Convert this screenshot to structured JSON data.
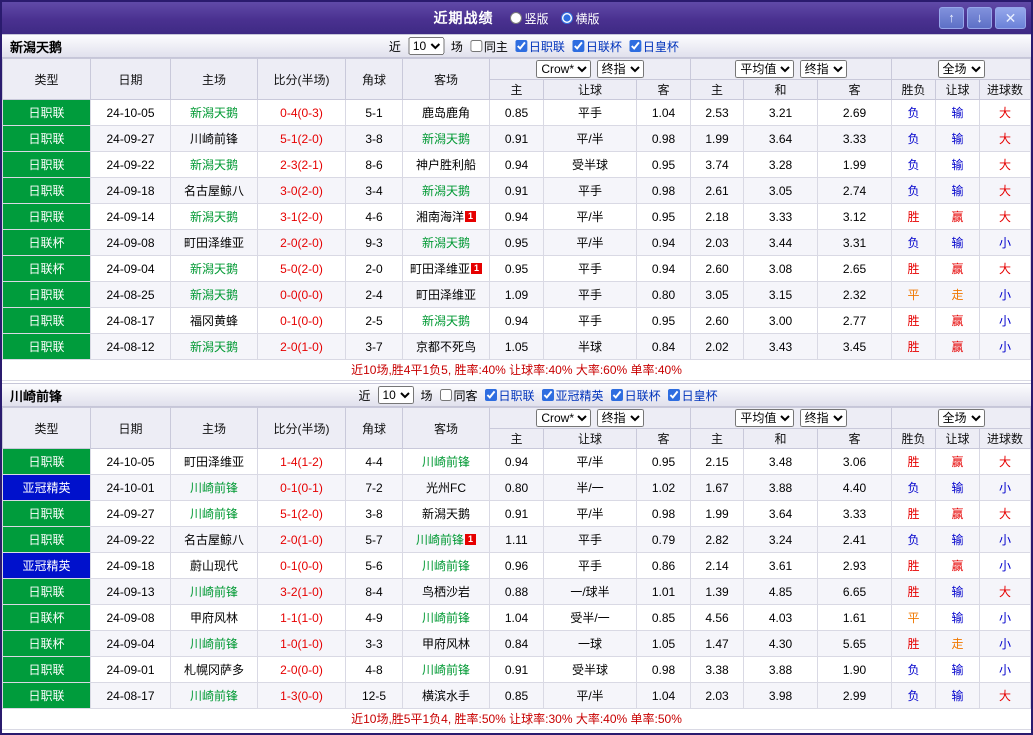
{
  "colors": {
    "accent_purple": "#4a3190",
    "league_green": "#009c3c",
    "league_blue": "#0011cc",
    "team_green": "#009933",
    "score_red": "#e60000",
    "lose_blue": "#0000cc",
    "draw_orange": "#f07800",
    "summary_red": "#c80000"
  },
  "titlebar": {
    "title": "近期战绩",
    "layout_options": [
      "竖版",
      "横版"
    ],
    "selected_layout": "横版",
    "up_glyph": "↑",
    "down_glyph": "↓",
    "close_glyph": "✕"
  },
  "filters": {
    "near": "近",
    "games_suffix": "场"
  },
  "table_header": {
    "type": "类型",
    "date": "日期",
    "home": "主场",
    "score": "比分(半场)",
    "corner": "角球",
    "away": "客场",
    "book_select": "Crow*",
    "final_select": "终指",
    "avg_select": "平均值",
    "scope_select": "全场",
    "sub": [
      "主",
      "让球",
      "客",
      "主",
      "和",
      "客",
      "胜负",
      "让球",
      "进球数"
    ]
  },
  "sections": [
    {
      "team": "新潟天鹅",
      "games": "10",
      "checkboxes": [
        {
          "label": "同主",
          "checked": false,
          "hl": false
        },
        {
          "label": "日职联",
          "checked": true,
          "hl": true
        },
        {
          "label": "日联杯",
          "checked": true,
          "hl": true
        },
        {
          "label": "日皇杯",
          "checked": true,
          "hl": true
        }
      ],
      "rows": [
        [
          {
            "t": "日职联",
            "c": "lg"
          },
          {
            "t": "24-10-05"
          },
          {
            "t": "新潟天鹅",
            "c": "tg"
          },
          {
            "t": "0-4(0-3)",
            "c": "sc"
          },
          {
            "t": "5-1"
          },
          {
            "t": "鹿岛鹿角"
          },
          {
            "t": "0.85"
          },
          {
            "t": "平手"
          },
          {
            "t": "1.04"
          },
          {
            "t": "2.53"
          },
          {
            "t": "3.21"
          },
          {
            "t": "2.69"
          },
          {
            "t": "负",
            "c": "bl"
          },
          {
            "t": "输",
            "c": "bl"
          },
          {
            "t": "大",
            "c": "rd"
          }
        ],
        [
          {
            "t": "日职联",
            "c": "lg"
          },
          {
            "t": "24-09-27"
          },
          {
            "t": "川崎前锋"
          },
          {
            "t": "5-1(2-0)",
            "c": "sc"
          },
          {
            "t": "3-8"
          },
          {
            "t": "新潟天鹅",
            "c": "tg"
          },
          {
            "t": "0.91"
          },
          {
            "t": "平/半"
          },
          {
            "t": "0.98"
          },
          {
            "t": "1.99"
          },
          {
            "t": "3.64"
          },
          {
            "t": "3.33"
          },
          {
            "t": "负",
            "c": "bl"
          },
          {
            "t": "输",
            "c": "bl"
          },
          {
            "t": "大",
            "c": "rd"
          }
        ],
        [
          {
            "t": "日职联",
            "c": "lg"
          },
          {
            "t": "24-09-22"
          },
          {
            "t": "新潟天鹅",
            "c": "tg"
          },
          {
            "t": "2-3(2-1)",
            "c": "sc"
          },
          {
            "t": "8-6"
          },
          {
            "t": "神户胜利船"
          },
          {
            "t": "0.94"
          },
          {
            "t": "受半球"
          },
          {
            "t": "0.95"
          },
          {
            "t": "3.74"
          },
          {
            "t": "3.28"
          },
          {
            "t": "1.99"
          },
          {
            "t": "负",
            "c": "bl"
          },
          {
            "t": "输",
            "c": "bl"
          },
          {
            "t": "大",
            "c": "rd"
          }
        ],
        [
          {
            "t": "日职联",
            "c": "lg"
          },
          {
            "t": "24-09-18"
          },
          {
            "t": "名古屋鲸八"
          },
          {
            "t": "3-0(2-0)",
            "c": "sc"
          },
          {
            "t": "3-4"
          },
          {
            "t": "新潟天鹅",
            "c": "tg"
          },
          {
            "t": "0.91"
          },
          {
            "t": "平手"
          },
          {
            "t": "0.98"
          },
          {
            "t": "2.61"
          },
          {
            "t": "3.05"
          },
          {
            "t": "2.74"
          },
          {
            "t": "负",
            "c": "bl"
          },
          {
            "t": "输",
            "c": "bl"
          },
          {
            "t": "大",
            "c": "rd"
          }
        ],
        [
          {
            "t": "日职联",
            "c": "lg"
          },
          {
            "t": "24-09-14"
          },
          {
            "t": "新潟天鹅",
            "c": "tg"
          },
          {
            "t": "3-1(2-0)",
            "c": "sc"
          },
          {
            "t": "4-6"
          },
          {
            "t": "湘南海洋",
            "b": "1"
          },
          {
            "t": "0.94"
          },
          {
            "t": "平/半"
          },
          {
            "t": "0.95"
          },
          {
            "t": "2.18"
          },
          {
            "t": "3.33"
          },
          {
            "t": "3.12"
          },
          {
            "t": "胜",
            "c": "rd"
          },
          {
            "t": "赢",
            "c": "rd"
          },
          {
            "t": "大",
            "c": "rd"
          }
        ],
        [
          {
            "t": "日联杯",
            "c": "lg"
          },
          {
            "t": "24-09-08"
          },
          {
            "t": "町田泽维亚"
          },
          {
            "t": "2-0(2-0)",
            "c": "sc"
          },
          {
            "t": "9-3"
          },
          {
            "t": "新潟天鹅",
            "c": "tg"
          },
          {
            "t": "0.95"
          },
          {
            "t": "平/半"
          },
          {
            "t": "0.94"
          },
          {
            "t": "2.03"
          },
          {
            "t": "3.44"
          },
          {
            "t": "3.31"
          },
          {
            "t": "负",
            "c": "bl"
          },
          {
            "t": "输",
            "c": "bl"
          },
          {
            "t": "小",
            "c": "bl"
          }
        ],
        [
          {
            "t": "日联杯",
            "c": "lg"
          },
          {
            "t": "24-09-04"
          },
          {
            "t": "新潟天鹅",
            "c": "tg"
          },
          {
            "t": "5-0(2-0)",
            "c": "sc"
          },
          {
            "t": "2-0"
          },
          {
            "t": "町田泽维亚",
            "b": "1"
          },
          {
            "t": "0.95"
          },
          {
            "t": "平手"
          },
          {
            "t": "0.94"
          },
          {
            "t": "2.60"
          },
          {
            "t": "3.08"
          },
          {
            "t": "2.65"
          },
          {
            "t": "胜",
            "c": "rd"
          },
          {
            "t": "赢",
            "c": "rd"
          },
          {
            "t": "大",
            "c": "rd"
          }
        ],
        [
          {
            "t": "日职联",
            "c": "lg"
          },
          {
            "t": "24-08-25"
          },
          {
            "t": "新潟天鹅",
            "c": "tg"
          },
          {
            "t": "0-0(0-0)",
            "c": "sc"
          },
          {
            "t": "2-4"
          },
          {
            "t": "町田泽维亚"
          },
          {
            "t": "1.09"
          },
          {
            "t": "平手"
          },
          {
            "t": "0.80"
          },
          {
            "t": "3.05"
          },
          {
            "t": "3.15"
          },
          {
            "t": "2.32"
          },
          {
            "t": "平",
            "c": "og"
          },
          {
            "t": "走",
            "c": "og"
          },
          {
            "t": "小",
            "c": "bl"
          }
        ],
        [
          {
            "t": "日职联",
            "c": "lg"
          },
          {
            "t": "24-08-17"
          },
          {
            "t": "福冈黄蜂"
          },
          {
            "t": "0-1(0-0)",
            "c": "sc"
          },
          {
            "t": "2-5"
          },
          {
            "t": "新潟天鹅",
            "c": "tg"
          },
          {
            "t": "0.94"
          },
          {
            "t": "平手"
          },
          {
            "t": "0.95"
          },
          {
            "t": "2.60"
          },
          {
            "t": "3.00"
          },
          {
            "t": "2.77"
          },
          {
            "t": "胜",
            "c": "rd"
          },
          {
            "t": "赢",
            "c": "rd"
          },
          {
            "t": "小",
            "c": "bl"
          }
        ],
        [
          {
            "t": "日职联",
            "c": "lg"
          },
          {
            "t": "24-08-12"
          },
          {
            "t": "新潟天鹅",
            "c": "tg"
          },
          {
            "t": "2-0(1-0)",
            "c": "sc"
          },
          {
            "t": "3-7"
          },
          {
            "t": "京都不死鸟"
          },
          {
            "t": "1.05"
          },
          {
            "t": "半球"
          },
          {
            "t": "0.84"
          },
          {
            "t": "2.02"
          },
          {
            "t": "3.43"
          },
          {
            "t": "3.45"
          },
          {
            "t": "胜",
            "c": "rd"
          },
          {
            "t": "赢",
            "c": "rd"
          },
          {
            "t": "小",
            "c": "bl"
          }
        ]
      ],
      "summary": "近10场,胜4平1负5, 胜率:40% 让球率:40% 大率:60% 单率:40%"
    },
    {
      "team": "川崎前锋",
      "games": "10",
      "checkboxes": [
        {
          "label": "同客",
          "checked": false,
          "hl": false
        },
        {
          "label": "日职联",
          "checked": true,
          "hl": true
        },
        {
          "label": "亚冠精英",
          "checked": true,
          "hl": true
        },
        {
          "label": "日联杯",
          "checked": true,
          "hl": true
        },
        {
          "label": "日皇杯",
          "checked": true,
          "hl": true
        }
      ],
      "rows": [
        [
          {
            "t": "日职联",
            "c": "lg"
          },
          {
            "t": "24-10-05"
          },
          {
            "t": "町田泽维亚"
          },
          {
            "t": "1-4(1-2)",
            "c": "sc"
          },
          {
            "t": "4-4"
          },
          {
            "t": "川崎前锋",
            "c": "tg"
          },
          {
            "t": "0.94"
          },
          {
            "t": "平/半"
          },
          {
            "t": "0.95"
          },
          {
            "t": "2.15"
          },
          {
            "t": "3.48"
          },
          {
            "t": "3.06"
          },
          {
            "t": "胜",
            "c": "rd"
          },
          {
            "t": "赢",
            "c": "rd"
          },
          {
            "t": "大",
            "c": "rd"
          }
        ],
        [
          {
            "t": "亚冠精英",
            "c": "lb"
          },
          {
            "t": "24-10-01"
          },
          {
            "t": "川崎前锋",
            "c": "tg"
          },
          {
            "t": "0-1(0-1)",
            "c": "sc"
          },
          {
            "t": "7-2"
          },
          {
            "t": "光州FC"
          },
          {
            "t": "0.80"
          },
          {
            "t": "半/一"
          },
          {
            "t": "1.02"
          },
          {
            "t": "1.67"
          },
          {
            "t": "3.88"
          },
          {
            "t": "4.40"
          },
          {
            "t": "负",
            "c": "bl"
          },
          {
            "t": "输",
            "c": "bl"
          },
          {
            "t": "小",
            "c": "bl"
          }
        ],
        [
          {
            "t": "日职联",
            "c": "lg"
          },
          {
            "t": "24-09-27"
          },
          {
            "t": "川崎前锋",
            "c": "tg"
          },
          {
            "t": "5-1(2-0)",
            "c": "sc"
          },
          {
            "t": "3-8"
          },
          {
            "t": "新潟天鹅"
          },
          {
            "t": "0.91"
          },
          {
            "t": "平/半"
          },
          {
            "t": "0.98"
          },
          {
            "t": "1.99"
          },
          {
            "t": "3.64"
          },
          {
            "t": "3.33"
          },
          {
            "t": "胜",
            "c": "rd"
          },
          {
            "t": "赢",
            "c": "rd"
          },
          {
            "t": "大",
            "c": "rd"
          }
        ],
        [
          {
            "t": "日职联",
            "c": "lg"
          },
          {
            "t": "24-09-22"
          },
          {
            "t": "名古屋鲸八"
          },
          {
            "t": "2-0(1-0)",
            "c": "sc"
          },
          {
            "t": "5-7"
          },
          {
            "t": "川崎前锋",
            "c": "tg",
            "b": "1"
          },
          {
            "t": "1.11"
          },
          {
            "t": "平手"
          },
          {
            "t": "0.79"
          },
          {
            "t": "2.82"
          },
          {
            "t": "3.24"
          },
          {
            "t": "2.41"
          },
          {
            "t": "负",
            "c": "bl"
          },
          {
            "t": "输",
            "c": "bl"
          },
          {
            "t": "小",
            "c": "bl"
          }
        ],
        [
          {
            "t": "亚冠精英",
            "c": "lb"
          },
          {
            "t": "24-09-18"
          },
          {
            "t": "蔚山现代"
          },
          {
            "t": "0-1(0-0)",
            "c": "sc"
          },
          {
            "t": "5-6"
          },
          {
            "t": "川崎前锋",
            "c": "tg"
          },
          {
            "t": "0.96"
          },
          {
            "t": "平手"
          },
          {
            "t": "0.86"
          },
          {
            "t": "2.14"
          },
          {
            "t": "3.61"
          },
          {
            "t": "2.93"
          },
          {
            "t": "胜",
            "c": "rd"
          },
          {
            "t": "赢",
            "c": "rd"
          },
          {
            "t": "小",
            "c": "bl"
          }
        ],
        [
          {
            "t": "日职联",
            "c": "lg"
          },
          {
            "t": "24-09-13"
          },
          {
            "t": "川崎前锋",
            "c": "tg"
          },
          {
            "t": "3-2(1-0)",
            "c": "sc"
          },
          {
            "t": "8-4"
          },
          {
            "t": "鸟栖沙岩"
          },
          {
            "t": "0.88"
          },
          {
            "t": "一/球半"
          },
          {
            "t": "1.01"
          },
          {
            "t": "1.39"
          },
          {
            "t": "4.85"
          },
          {
            "t": "6.65"
          },
          {
            "t": "胜",
            "c": "rd"
          },
          {
            "t": "输",
            "c": "bl"
          },
          {
            "t": "大",
            "c": "rd"
          }
        ],
        [
          {
            "t": "日联杯",
            "c": "lg"
          },
          {
            "t": "24-09-08"
          },
          {
            "t": "甲府风林"
          },
          {
            "t": "1-1(1-0)",
            "c": "sc"
          },
          {
            "t": "4-9"
          },
          {
            "t": "川崎前锋",
            "c": "tg"
          },
          {
            "t": "1.04"
          },
          {
            "t": "受半/一"
          },
          {
            "t": "0.85"
          },
          {
            "t": "4.56"
          },
          {
            "t": "4.03"
          },
          {
            "t": "1.61"
          },
          {
            "t": "平",
            "c": "og"
          },
          {
            "t": "输",
            "c": "bl"
          },
          {
            "t": "小",
            "c": "bl"
          }
        ],
        [
          {
            "t": "日联杯",
            "c": "lg"
          },
          {
            "t": "24-09-04"
          },
          {
            "t": "川崎前锋",
            "c": "tg"
          },
          {
            "t": "1-0(1-0)",
            "c": "sc"
          },
          {
            "t": "3-3"
          },
          {
            "t": "甲府风林"
          },
          {
            "t": "0.84"
          },
          {
            "t": "一球"
          },
          {
            "t": "1.05"
          },
          {
            "t": "1.47"
          },
          {
            "t": "4.30"
          },
          {
            "t": "5.65"
          },
          {
            "t": "胜",
            "c": "rd"
          },
          {
            "t": "走",
            "c": "og"
          },
          {
            "t": "小",
            "c": "bl"
          }
        ],
        [
          {
            "t": "日职联",
            "c": "lg"
          },
          {
            "t": "24-09-01"
          },
          {
            "t": "札幌冈萨多"
          },
          {
            "t": "2-0(0-0)",
            "c": "sc"
          },
          {
            "t": "4-8"
          },
          {
            "t": "川崎前锋",
            "c": "tg"
          },
          {
            "t": "0.91"
          },
          {
            "t": "受半球"
          },
          {
            "t": "0.98"
          },
          {
            "t": "3.38"
          },
          {
            "t": "3.88"
          },
          {
            "t": "1.90"
          },
          {
            "t": "负",
            "c": "bl"
          },
          {
            "t": "输",
            "c": "bl"
          },
          {
            "t": "小",
            "c": "bl"
          }
        ],
        [
          {
            "t": "日职联",
            "c": "lg"
          },
          {
            "t": "24-08-17"
          },
          {
            "t": "川崎前锋",
            "c": "tg"
          },
          {
            "t": "1-3(0-0)",
            "c": "sc"
          },
          {
            "t": "12-5"
          },
          {
            "t": "横滨水手"
          },
          {
            "t": "0.85"
          },
          {
            "t": "平/半"
          },
          {
            "t": "1.04"
          },
          {
            "t": "2.03"
          },
          {
            "t": "3.98"
          },
          {
            "t": "2.99"
          },
          {
            "t": "负",
            "c": "bl"
          },
          {
            "t": "输",
            "c": "bl"
          },
          {
            "t": "大",
            "c": "rd"
          }
        ]
      ],
      "summary": "近10场,胜5平1负4, 胜率:50% 让球率:30% 大率:40% 单率:50%"
    }
  ]
}
